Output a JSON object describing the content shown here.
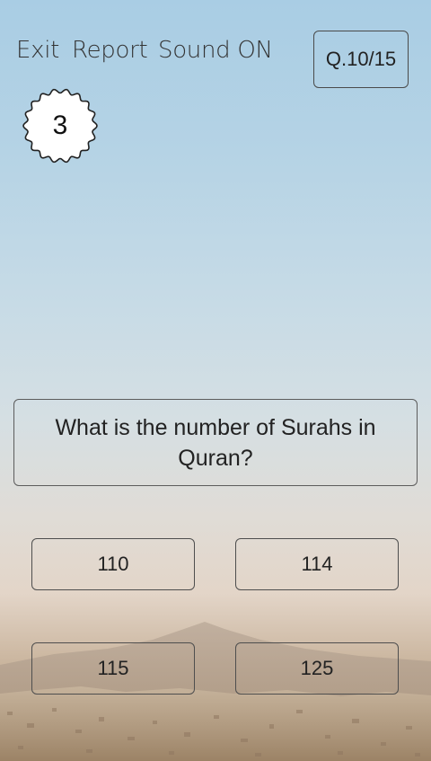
{
  "topbar": {
    "exit_label": "Exit",
    "report_label": "Report",
    "sound_label": "Sound ON",
    "question_counter": "Q.10/15"
  },
  "timer": {
    "value": "3"
  },
  "question": {
    "text": "What is the number of Surahs in Quran?"
  },
  "answers": [
    {
      "label": "110"
    },
    {
      "label": "114"
    },
    {
      "label": "115"
    },
    {
      "label": "125"
    }
  ],
  "colors": {
    "sky_top": "#a9cde4",
    "horizon": "#e0dcd6",
    "ground": "#a68f74",
    "border": "#4e4e4e"
  }
}
